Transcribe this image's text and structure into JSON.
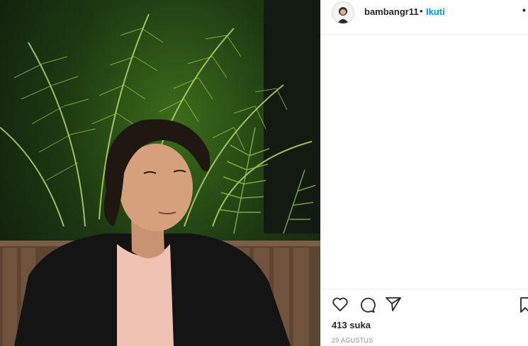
{
  "post": {
    "username": "bambangr11",
    "separator": "•",
    "follow_label": "Ikuti",
    "more_label": "•",
    "likes_text": "413 suka",
    "date_text": "29 AGUSTUS"
  },
  "icons": {
    "avatar": "profile-avatar",
    "like": "heart-icon",
    "comment": "comment-icon",
    "share": "send-icon",
    "save": "bookmark-icon"
  },
  "colors": {
    "link": "#0095f6",
    "text": "#262626",
    "muted": "#8e8e8e",
    "divider": "#efefef"
  }
}
